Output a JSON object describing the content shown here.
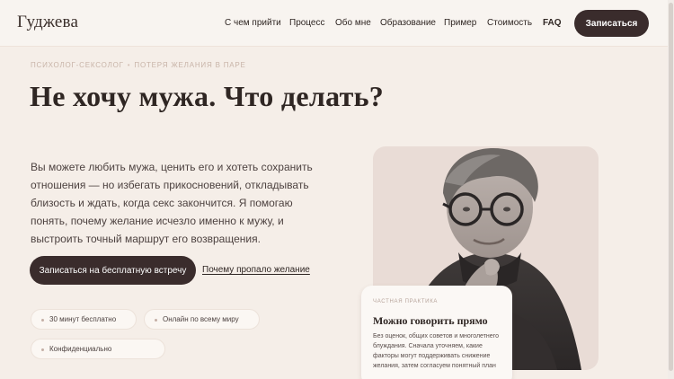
{
  "header": {
    "logo": "Гуджева",
    "nav": [
      "С чем прийти",
      "Процесс",
      "Обо мне",
      "Образование",
      "Пример",
      "Стоимость",
      "FAQ"
    ],
    "cta_label": "Записаться"
  },
  "hero": {
    "breadcrumb": [
      "Психолог-сексолог",
      "Потеря желания в паре"
    ],
    "title": "Не хочу мужа. Что делать?",
    "lead": "Вы можете любить мужа, ценить его и хотеть сохранить отношения — но избегать прикосновений, откладывать близость и ждать, когда секс закончится. Я помогаю понять, почему желание исчезло именно к мужу, и выстроить точный маршрут его возвращения.",
    "primary_button": "Записаться на бесплатную встречу",
    "secondary_link": "Почему пропало желание",
    "chips": [
      "30 минут бесплатно",
      "Онлайн по всему миру",
      "Конфиденциально"
    ]
  },
  "quote_card": {
    "label": "Частная практика",
    "heading": "Можно говорить прямо",
    "body": "Без оценок, общих советов и многолетнего блуждания. Сначала уточняем, какие факторы могут поддерживать снижение желания, затем согласуем понятный план"
  },
  "colors": {
    "page_bg": "#f5eee8",
    "dark_button": "#3a2c2c",
    "photo_bg": "#e9dcd6",
    "breadcrumb": "#c8b4a8"
  },
  "icons": [
    "chip-dot-icon"
  ]
}
